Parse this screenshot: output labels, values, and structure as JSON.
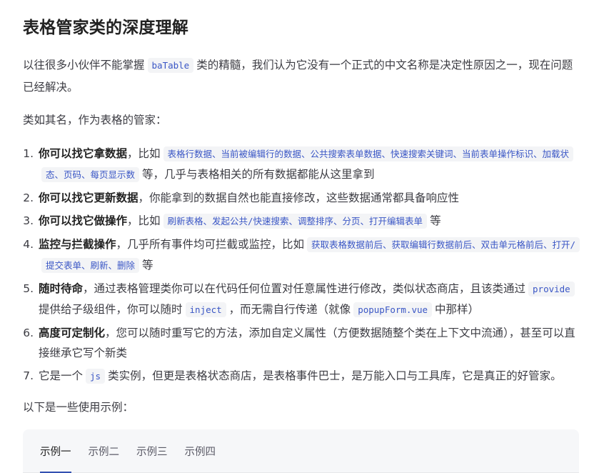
{
  "doc": {
    "title": "表格管家类的深度理解",
    "intro": {
      "before": "以往很多小伙伴不能掌握",
      "code": "baTable",
      "after": "类的精髓，我们认为它没有一个正式的中文名称是决定性原因之一，现在问题已经解决。"
    },
    "lead": "类如其名，作为表格的管家：",
    "items": [
      {
        "bold": "你可以找它拿数据",
        "text1": "，比如",
        "code": "表格行数据、当前被编辑行的数据、公共搜索表单数据、快速搜索关键词、当前表单操作标识、加载状态、页码、每页显示数",
        "text2": "等，几乎与表格相关的所有数据都能从这里拿到"
      },
      {
        "bold": "你可以找它更新数据",
        "text1": "，你能拿到的数据自然也能直接修改，这些数据通常都具备响应性"
      },
      {
        "bold": "你可以找它做操作",
        "text1": "，比如",
        "code": "刷新表格、发起公共/快速搜索、调整排序、分页、打开编辑表单",
        "text2": "等"
      },
      {
        "bold": "监控与拦截操作",
        "text1": "，几乎所有事件均可拦截或监控，比如",
        "code": "获取表格数据前后、获取编辑行数据前后、双击单元格前后、打开/提交表单、刷新、删除",
        "text2": "等"
      },
      {
        "bold": "随时待命",
        "text1": "，通过表格管理类你可以在代码任何位置对任意属性进行修改，类似状态商店，且该类通过",
        "code": "provide",
        "text2": "提供给子级组件，你可以随时",
        "code2": "inject",
        "text3": "，而无需自行传递（就像",
        "code3": "popupForm.vue",
        "text4": "中那样）"
      },
      {
        "bold": "高度可定制化",
        "text1": "，您可以随时重写它的方法，添加自定义属性（方便数据随整个类在上下文中流通），甚至可以直接继承它写个新类"
      },
      {
        "text1": "它是一个",
        "code": "js",
        "text2": "类实例，但更是表格状态商店，是表格事件巴士，是万能入口与工具库，它是真正的好管家。"
      }
    ],
    "examples_lead": "以下是一些使用示例：",
    "tabs": [
      "示例一",
      "示例二",
      "示例三",
      "示例四"
    ],
    "active_tab": 0
  }
}
